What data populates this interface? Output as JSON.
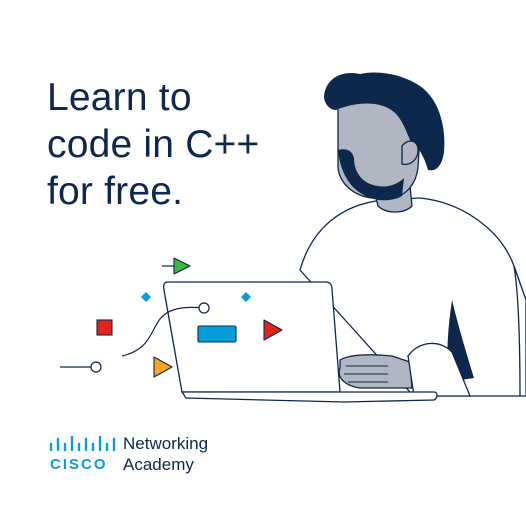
{
  "headline": {
    "line1": "Learn to",
    "line2": "code in C++",
    "line3": "for free."
  },
  "brand": {
    "logo_text": "CISCO",
    "program_line1": "Networking",
    "program_line2": "Academy"
  },
  "colors": {
    "navy": "#0d274d",
    "cisco_blue": "#049fd9",
    "green": "#3ab83a",
    "red": "#e2231a",
    "orange": "#f6a623",
    "skin_gray": "#b0b7c3"
  }
}
